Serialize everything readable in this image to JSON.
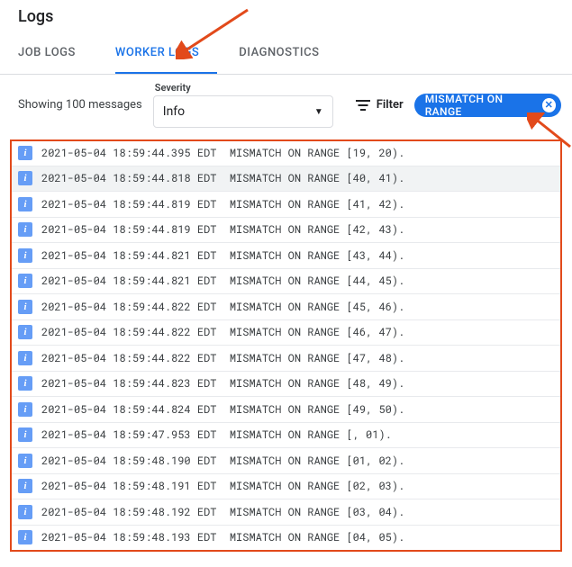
{
  "title": "Logs",
  "tabs": [
    {
      "label": "JOB LOGS",
      "active": false
    },
    {
      "label": "WORKER LOGS",
      "active": true
    },
    {
      "label": "DIAGNOSTICS",
      "active": false
    }
  ],
  "controls": {
    "showing": "Showing 100 messages",
    "severity_label": "Severity",
    "severity_value": "Info",
    "filter_label": "Filter",
    "chip_label": "MISMATCH ON RANGE"
  },
  "log_prefix_template": "{ts}  MISMATCH ON RANGE [{a}, {b}).",
  "logs": [
    {
      "ts": "2021-05-04 18:59:44.395 EDT",
      "a": "19",
      "b": "20"
    },
    {
      "ts": "2021-05-04 18:59:44.818 EDT",
      "a": "40",
      "b": "41"
    },
    {
      "ts": "2021-05-04 18:59:44.819 EDT",
      "a": "41",
      "b": "42"
    },
    {
      "ts": "2021-05-04 18:59:44.819 EDT",
      "a": "42",
      "b": "43"
    },
    {
      "ts": "2021-05-04 18:59:44.821 EDT",
      "a": "43",
      "b": "44"
    },
    {
      "ts": "2021-05-04 18:59:44.821 EDT",
      "a": "44",
      "b": "45"
    },
    {
      "ts": "2021-05-04 18:59:44.822 EDT",
      "a": "45",
      "b": "46"
    },
    {
      "ts": "2021-05-04 18:59:44.822 EDT",
      "a": "46",
      "b": "47"
    },
    {
      "ts": "2021-05-04 18:59:44.822 EDT",
      "a": "47",
      "b": "48"
    },
    {
      "ts": "2021-05-04 18:59:44.823 EDT",
      "a": "48",
      "b": "49"
    },
    {
      "ts": "2021-05-04 18:59:44.824 EDT",
      "a": "49",
      "b": "50"
    },
    {
      "ts": "2021-05-04 18:59:47.953 EDT",
      "a": "",
      "b": "01"
    },
    {
      "ts": "2021-05-04 18:59:48.190 EDT",
      "a": "01",
      "b": "02"
    },
    {
      "ts": "2021-05-04 18:59:48.191 EDT",
      "a": "02",
      "b": "03"
    },
    {
      "ts": "2021-05-04 18:59:48.192 EDT",
      "a": "03",
      "b": "04"
    },
    {
      "ts": "2021-05-04 18:59:48.193 EDT",
      "a": "04",
      "b": "05"
    }
  ]
}
